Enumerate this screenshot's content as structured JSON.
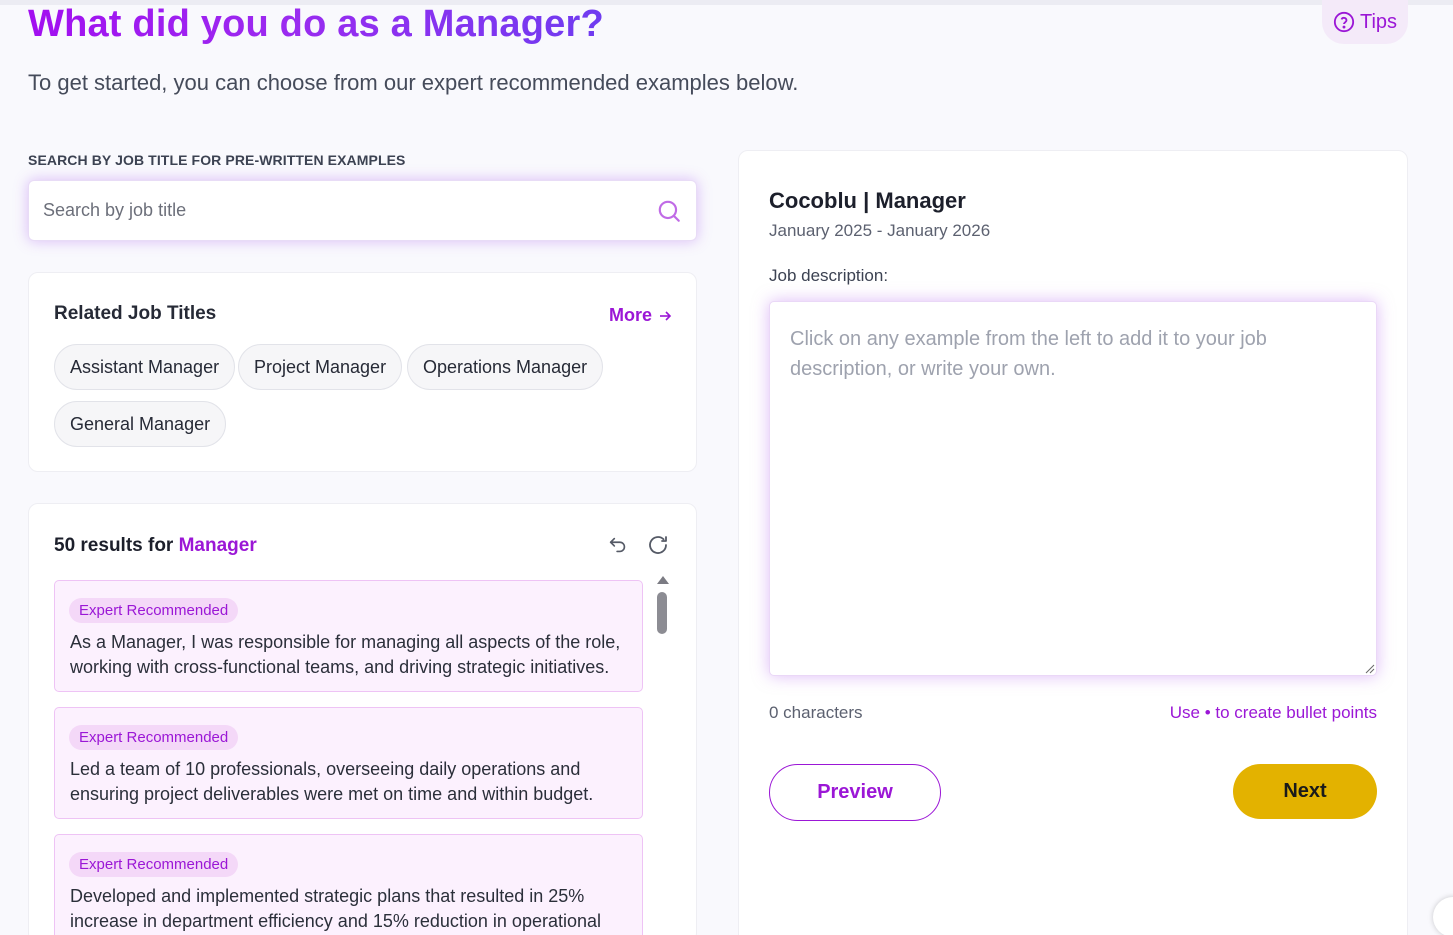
{
  "header": {
    "title": "What did you do as a Manager?",
    "subtitle": "To get started, you can choose from our expert recommended examples below.",
    "tips_label": "Tips"
  },
  "search": {
    "heading": "SEARCH BY JOB TITLE FOR PRE-WRITTEN EXAMPLES",
    "placeholder": "Search by job title",
    "value": ""
  },
  "related": {
    "title": "Related Job Titles",
    "more_label": "More",
    "chips": [
      "Assistant Manager",
      "Project Manager",
      "Operations Manager",
      "General Manager"
    ]
  },
  "results": {
    "count_prefix": "50 results for ",
    "query": "Manager",
    "examples": [
      {
        "badge": "Expert Recommended",
        "text": "As a Manager, I was responsible for managing all aspects of the role, working with cross-functional teams, and driving strategic initiatives."
      },
      {
        "badge": "Expert Recommended",
        "text": "Led a team of 10 professionals, overseeing daily operations and ensuring project deliverables were met on time and within budget."
      },
      {
        "badge": "Expert Recommended",
        "text": "Developed and implemented strategic plans that resulted in 25% increase in department efficiency and 15% reduction in operational"
      }
    ]
  },
  "job": {
    "heading": "Cocoblu | Manager",
    "dates": "January 2025 - January 2026",
    "description_label": "Job description:",
    "description_placeholder": "Click on any example from the left to add it to your job description, or write your own.",
    "description_value": "",
    "char_count": "0 characters",
    "bullet_hint": "Use • to create bullet points",
    "preview_label": "Preview",
    "next_label": "Next"
  },
  "colors": {
    "accent": "#9b17d6",
    "next_button": "#e3b200",
    "example_bg": "#fcf1fe"
  },
  "icons": [
    "help-circle-icon",
    "search-icon",
    "arrow-right-icon",
    "undo-icon",
    "refresh-icon",
    "resize-grip-icon"
  ]
}
